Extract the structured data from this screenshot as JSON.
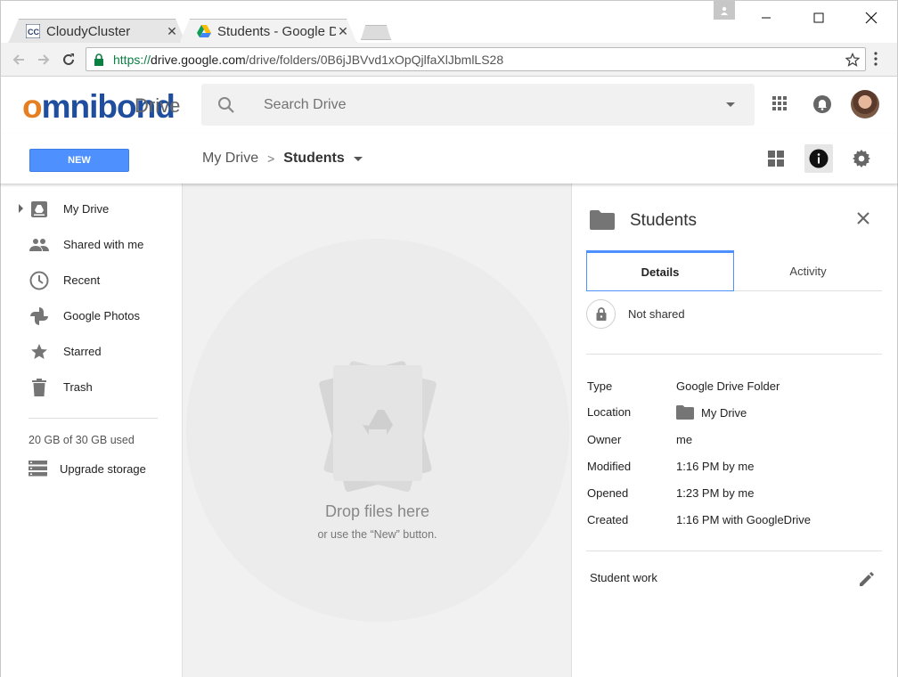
{
  "browser": {
    "tabs": [
      {
        "title": "CloudyCluster",
        "favicon": "cloudycluster-icon",
        "active": false
      },
      {
        "title": "Students - Google D",
        "favicon": "google-drive-icon",
        "active": true
      }
    ],
    "url_prefix": "https://",
    "url_host": "drive.google.com",
    "url_path": "/drive/folders/0B6jJBVvd1xOpQjlfaXlJbmlLS28"
  },
  "header": {
    "logo_text_o": "o",
    "logo_text_rest": "mnibond",
    "product_name": "Drive",
    "search_placeholder": "Search Drive"
  },
  "toolbar": {
    "new_label": "NEW",
    "breadcrumb": [
      {
        "label": "My Drive"
      },
      {
        "label": "Students"
      }
    ],
    "separator": ">"
  },
  "sidebar": {
    "items": [
      {
        "label": "My Drive",
        "icon": "my-drive-icon"
      },
      {
        "label": "Shared with me",
        "icon": "shared-people-icon"
      },
      {
        "label": "Recent",
        "icon": "clock-icon"
      },
      {
        "label": "Google Photos",
        "icon": "pinwheel-icon"
      },
      {
        "label": "Starred",
        "icon": "star-icon"
      },
      {
        "label": "Trash",
        "icon": "trash-icon"
      }
    ],
    "storage_text": "20 GB of 30 GB used",
    "upgrade_label": "Upgrade storage"
  },
  "main": {
    "drop_title": "Drop files here",
    "drop_subtitle": "or use the “New” button."
  },
  "details": {
    "title": "Students",
    "tabs": [
      {
        "label": "Details",
        "active": true
      },
      {
        "label": "Activity",
        "active": false
      }
    ],
    "sharing": "Not shared",
    "properties": [
      {
        "key": "Type",
        "value": "Google Drive Folder"
      },
      {
        "key": "Location",
        "value": "My Drive"
      },
      {
        "key": "Owner",
        "value": "me"
      },
      {
        "key": "Modified",
        "value": "1:16 PM by me"
      },
      {
        "key": "Opened",
        "value": "1:23 PM by me"
      },
      {
        "key": "Created",
        "value": "1:16 PM with GoogleDrive"
      }
    ],
    "description": "Student work"
  },
  "colors": {
    "accent_blue": "#4d90fe",
    "logo_blue": "#1f4e9e",
    "logo_orange": "#e67e22",
    "icon_gray": "#757575"
  }
}
